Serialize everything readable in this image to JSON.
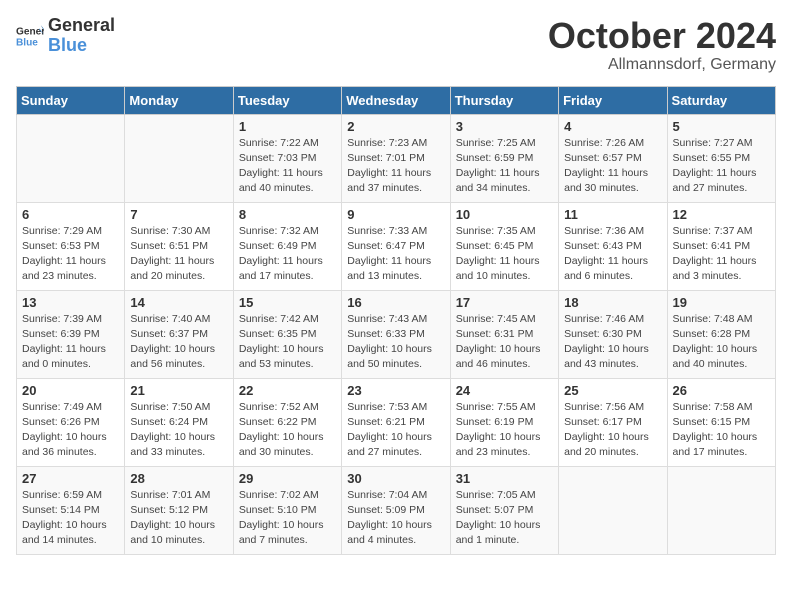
{
  "header": {
    "logo_general": "General",
    "logo_blue": "Blue",
    "month": "October 2024",
    "location": "Allmannsdorf, Germany"
  },
  "weekdays": [
    "Sunday",
    "Monday",
    "Tuesday",
    "Wednesday",
    "Thursday",
    "Friday",
    "Saturday"
  ],
  "weeks": [
    [
      {
        "day": "",
        "info": ""
      },
      {
        "day": "",
        "info": ""
      },
      {
        "day": "1",
        "info": "Sunrise: 7:22 AM\nSunset: 7:03 PM\nDaylight: 11 hours\nand 40 minutes."
      },
      {
        "day": "2",
        "info": "Sunrise: 7:23 AM\nSunset: 7:01 PM\nDaylight: 11 hours\nand 37 minutes."
      },
      {
        "day": "3",
        "info": "Sunrise: 7:25 AM\nSunset: 6:59 PM\nDaylight: 11 hours\nand 34 minutes."
      },
      {
        "day": "4",
        "info": "Sunrise: 7:26 AM\nSunset: 6:57 PM\nDaylight: 11 hours\nand 30 minutes."
      },
      {
        "day": "5",
        "info": "Sunrise: 7:27 AM\nSunset: 6:55 PM\nDaylight: 11 hours\nand 27 minutes."
      }
    ],
    [
      {
        "day": "6",
        "info": "Sunrise: 7:29 AM\nSunset: 6:53 PM\nDaylight: 11 hours\nand 23 minutes."
      },
      {
        "day": "7",
        "info": "Sunrise: 7:30 AM\nSunset: 6:51 PM\nDaylight: 11 hours\nand 20 minutes."
      },
      {
        "day": "8",
        "info": "Sunrise: 7:32 AM\nSunset: 6:49 PM\nDaylight: 11 hours\nand 17 minutes."
      },
      {
        "day": "9",
        "info": "Sunrise: 7:33 AM\nSunset: 6:47 PM\nDaylight: 11 hours\nand 13 minutes."
      },
      {
        "day": "10",
        "info": "Sunrise: 7:35 AM\nSunset: 6:45 PM\nDaylight: 11 hours\nand 10 minutes."
      },
      {
        "day": "11",
        "info": "Sunrise: 7:36 AM\nSunset: 6:43 PM\nDaylight: 11 hours\nand 6 minutes."
      },
      {
        "day": "12",
        "info": "Sunrise: 7:37 AM\nSunset: 6:41 PM\nDaylight: 11 hours\nand 3 minutes."
      }
    ],
    [
      {
        "day": "13",
        "info": "Sunrise: 7:39 AM\nSunset: 6:39 PM\nDaylight: 11 hours\nand 0 minutes."
      },
      {
        "day": "14",
        "info": "Sunrise: 7:40 AM\nSunset: 6:37 PM\nDaylight: 10 hours\nand 56 minutes."
      },
      {
        "day": "15",
        "info": "Sunrise: 7:42 AM\nSunset: 6:35 PM\nDaylight: 10 hours\nand 53 minutes."
      },
      {
        "day": "16",
        "info": "Sunrise: 7:43 AM\nSunset: 6:33 PM\nDaylight: 10 hours\nand 50 minutes."
      },
      {
        "day": "17",
        "info": "Sunrise: 7:45 AM\nSunset: 6:31 PM\nDaylight: 10 hours\nand 46 minutes."
      },
      {
        "day": "18",
        "info": "Sunrise: 7:46 AM\nSunset: 6:30 PM\nDaylight: 10 hours\nand 43 minutes."
      },
      {
        "day": "19",
        "info": "Sunrise: 7:48 AM\nSunset: 6:28 PM\nDaylight: 10 hours\nand 40 minutes."
      }
    ],
    [
      {
        "day": "20",
        "info": "Sunrise: 7:49 AM\nSunset: 6:26 PM\nDaylight: 10 hours\nand 36 minutes."
      },
      {
        "day": "21",
        "info": "Sunrise: 7:50 AM\nSunset: 6:24 PM\nDaylight: 10 hours\nand 33 minutes."
      },
      {
        "day": "22",
        "info": "Sunrise: 7:52 AM\nSunset: 6:22 PM\nDaylight: 10 hours\nand 30 minutes."
      },
      {
        "day": "23",
        "info": "Sunrise: 7:53 AM\nSunset: 6:21 PM\nDaylight: 10 hours\nand 27 minutes."
      },
      {
        "day": "24",
        "info": "Sunrise: 7:55 AM\nSunset: 6:19 PM\nDaylight: 10 hours\nand 23 minutes."
      },
      {
        "day": "25",
        "info": "Sunrise: 7:56 AM\nSunset: 6:17 PM\nDaylight: 10 hours\nand 20 minutes."
      },
      {
        "day": "26",
        "info": "Sunrise: 7:58 AM\nSunset: 6:15 PM\nDaylight: 10 hours\nand 17 minutes."
      }
    ],
    [
      {
        "day": "27",
        "info": "Sunrise: 6:59 AM\nSunset: 5:14 PM\nDaylight: 10 hours\nand 14 minutes."
      },
      {
        "day": "28",
        "info": "Sunrise: 7:01 AM\nSunset: 5:12 PM\nDaylight: 10 hours\nand 10 minutes."
      },
      {
        "day": "29",
        "info": "Sunrise: 7:02 AM\nSunset: 5:10 PM\nDaylight: 10 hours\nand 7 minutes."
      },
      {
        "day": "30",
        "info": "Sunrise: 7:04 AM\nSunset: 5:09 PM\nDaylight: 10 hours\nand 4 minutes."
      },
      {
        "day": "31",
        "info": "Sunrise: 7:05 AM\nSunset: 5:07 PM\nDaylight: 10 hours\nand 1 minute."
      },
      {
        "day": "",
        "info": ""
      },
      {
        "day": "",
        "info": ""
      }
    ]
  ]
}
